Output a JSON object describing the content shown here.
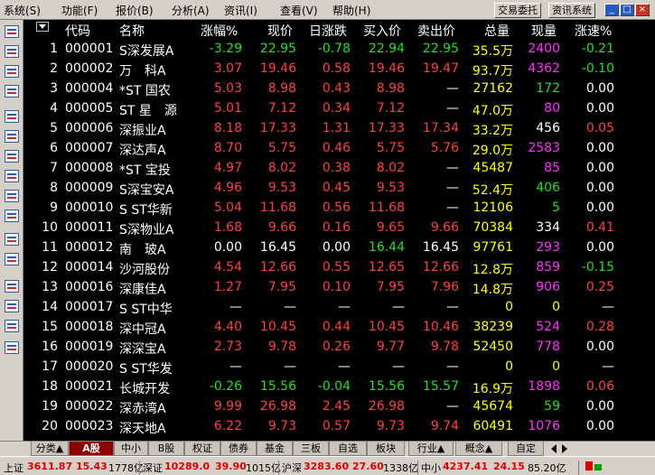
{
  "menu": [
    {
      "label": "系统(S)"
    },
    {
      "label": "功能(F)"
    },
    {
      "label": "报价(B)"
    },
    {
      "label": "分析(A)"
    },
    {
      "label": "资讯(I)"
    },
    {
      "label": "查看(V)"
    },
    {
      "label": "帮助(H)"
    }
  ],
  "toolbar": {
    "trade_label": "交易委托",
    "news_label": "资讯系统"
  },
  "columns": [
    "代码",
    "名称",
    "涨幅%",
    "现价",
    "日涨跌",
    "买入价",
    "卖出价",
    "总量",
    "现量",
    "涨速%"
  ],
  "rows": [
    {
      "n": "1",
      "code": "000001",
      "name": "S深发展A",
      "pct": "-3.29",
      "price": "22.95",
      "chg": "-0.78",
      "bid": "22.94",
      "ask": "22.95",
      "vol": "35.5万",
      "cur": "2400",
      "spd": "-0.21",
      "c": [
        "g",
        "g",
        "g",
        "g",
        "g",
        "m",
        "g"
      ]
    },
    {
      "n": "2",
      "code": "000002",
      "name": "万　科A",
      "pct": "3.07",
      "price": "19.46",
      "chg": "0.58",
      "bid": "19.46",
      "ask": "19.47",
      "vol": "93.7万",
      "cur": "4362",
      "spd": "-0.10",
      "c": [
        "r",
        "r",
        "r",
        "r",
        "r",
        "m",
        "g"
      ]
    },
    {
      "n": "3",
      "code": "000004",
      "name": "*ST 国农",
      "pct": "5.03",
      "price": "8.98",
      "chg": "0.43",
      "bid": "8.98",
      "ask": "—",
      "vol": "27162",
      "cur": "172",
      "spd": "0.00",
      "c": [
        "r",
        "r",
        "r",
        "r",
        "w",
        "g",
        "w"
      ]
    },
    {
      "n": "4",
      "code": "000005",
      "name": "ST 星　源",
      "pct": "5.01",
      "price": "7.12",
      "chg": "0.34",
      "bid": "7.12",
      "ask": "—",
      "vol": "47.0万",
      "cur": "80",
      "spd": "0.00",
      "c": [
        "r",
        "r",
        "r",
        "r",
        "w",
        "m",
        "w"
      ]
    },
    {
      "n": "5",
      "code": "000006",
      "name": "深振业A",
      "pct": "8.18",
      "price": "17.33",
      "chg": "1.31",
      "bid": "17.33",
      "ask": "17.34",
      "vol": "33.2万",
      "cur": "456",
      "spd": "0.05",
      "c": [
        "r",
        "r",
        "r",
        "r",
        "r",
        "w",
        "r"
      ]
    },
    {
      "n": "6",
      "code": "000007",
      "name": "深达声A",
      "pct": "8.70",
      "price": "5.75",
      "chg": "0.46",
      "bid": "5.75",
      "ask": "5.76",
      "vol": "29.0万",
      "cur": "2583",
      "spd": "0.00",
      "c": [
        "r",
        "r",
        "r",
        "r",
        "r",
        "m",
        "w"
      ]
    },
    {
      "n": "7",
      "code": "000008",
      "name": "*ST 宝投",
      "pct": "4.97",
      "price": "8.02",
      "chg": "0.38",
      "bid": "8.02",
      "ask": "—",
      "vol": "45487",
      "cur": "85",
      "spd": "0.00",
      "c": [
        "r",
        "r",
        "r",
        "r",
        "w",
        "m",
        "w"
      ]
    },
    {
      "n": "8",
      "code": "000009",
      "name": "S深宝安A",
      "pct": "4.96",
      "price": "9.53",
      "chg": "0.45",
      "bid": "9.53",
      "ask": "—",
      "vol": "52.4万",
      "cur": "406",
      "spd": "0.00",
      "c": [
        "r",
        "r",
        "r",
        "r",
        "w",
        "g",
        "w"
      ]
    },
    {
      "n": "9",
      "code": "000010",
      "name": "S ST华新",
      "pct": "5.04",
      "price": "11.68",
      "chg": "0.56",
      "bid": "11.68",
      "ask": "—",
      "vol": "12106",
      "cur": "5",
      "spd": "0.00",
      "c": [
        "r",
        "r",
        "r",
        "r",
        "w",
        "g",
        "w"
      ]
    },
    {
      "n": "10",
      "code": "000011",
      "name": "S深物业A",
      "pct": "1.68",
      "price": "9.66",
      "chg": "0.16",
      "bid": "9.65",
      "ask": "9.66",
      "vol": "70384",
      "cur": "334",
      "spd": "0.41",
      "c": [
        "r",
        "r",
        "r",
        "r",
        "r",
        "w",
        "r"
      ]
    },
    {
      "n": "11",
      "code": "000012",
      "name": "南　玻A",
      "pct": "0.00",
      "price": "16.45",
      "chg": "0.00",
      "bid": "16.44",
      "ask": "16.45",
      "vol": "97761",
      "cur": "293",
      "spd": "0.00",
      "c": [
        "w",
        "w",
        "w",
        "g",
        "w",
        "m",
        "w"
      ]
    },
    {
      "n": "12",
      "code": "000014",
      "name": "沙河股份",
      "pct": "4.54",
      "price": "12.66",
      "chg": "0.55",
      "bid": "12.65",
      "ask": "12.66",
      "vol": "12.8万",
      "cur": "859",
      "spd": "-0.15",
      "c": [
        "r",
        "r",
        "r",
        "r",
        "r",
        "m",
        "g"
      ]
    },
    {
      "n": "13",
      "code": "000016",
      "name": "深康佳A",
      "pct": "1.27",
      "price": "7.95",
      "chg": "0.10",
      "bid": "7.95",
      "ask": "7.96",
      "vol": "14.8万",
      "cur": "906",
      "spd": "0.25",
      "c": [
        "r",
        "r",
        "r",
        "r",
        "r",
        "m",
        "r"
      ]
    },
    {
      "n": "14",
      "code": "000017",
      "name": "S ST中华",
      "pct": "—",
      "price": "—",
      "chg": "—",
      "bid": "—",
      "ask": "—",
      "vol": "0",
      "cur": "0",
      "spd": "—",
      "c": [
        "w",
        "w",
        "w",
        "w",
        "w",
        "y",
        "w"
      ]
    },
    {
      "n": "15",
      "code": "000018",
      "name": "深中冠A",
      "pct": "4.40",
      "price": "10.45",
      "chg": "0.44",
      "bid": "10.45",
      "ask": "10.46",
      "vol": "38239",
      "cur": "524",
      "spd": "0.28",
      "c": [
        "r",
        "r",
        "r",
        "r",
        "r",
        "m",
        "r"
      ]
    },
    {
      "n": "16",
      "code": "000019",
      "name": "深深宝A",
      "pct": "2.73",
      "price": "9.78",
      "chg": "0.26",
      "bid": "9.77",
      "ask": "9.78",
      "vol": "52450",
      "cur": "778",
      "spd": "0.00",
      "c": [
        "r",
        "r",
        "r",
        "r",
        "r",
        "m",
        "w"
      ]
    },
    {
      "n": "17",
      "code": "000020",
      "name": "S ST华发",
      "pct": "—",
      "price": "—",
      "chg": "—",
      "bid": "—",
      "ask": "—",
      "vol": "0",
      "cur": "0",
      "spd": "—",
      "c": [
        "w",
        "w",
        "w",
        "w",
        "w",
        "y",
        "w"
      ]
    },
    {
      "n": "18",
      "code": "000021",
      "name": "长城开发",
      "pct": "-0.26",
      "price": "15.56",
      "chg": "-0.04",
      "bid": "15.56",
      "ask": "15.57",
      "vol": "16.9万",
      "cur": "1898",
      "spd": "0.06",
      "c": [
        "g",
        "g",
        "g",
        "g",
        "g",
        "m",
        "r"
      ]
    },
    {
      "n": "19",
      "code": "000022",
      "name": "深赤湾A",
      "pct": "9.99",
      "price": "26.98",
      "chg": "2.45",
      "bid": "26.98",
      "ask": "—",
      "vol": "45674",
      "cur": "59",
      "spd": "0.00",
      "c": [
        "r",
        "r",
        "r",
        "r",
        "w",
        "g",
        "w"
      ]
    },
    {
      "n": "20",
      "code": "000023",
      "name": "深天地A",
      "pct": "6.22",
      "price": "9.73",
      "chg": "0.57",
      "bid": "9.73",
      "ask": "9.74",
      "vol": "60491",
      "cur": "1076",
      "spd": "0.00",
      "c": [
        "r",
        "r",
        "r",
        "r",
        "r",
        "m",
        "w"
      ]
    }
  ],
  "tabs": [
    "分类▲",
    "A股",
    "中小",
    "B股",
    "权证",
    "债券",
    "基金",
    "三板",
    "自选",
    "板块",
    "行业▲",
    "概念▲",
    "自定"
  ],
  "status": {
    "sh_label": "上证",
    "sh_value": "3611.87",
    "sh_chg": "15.43",
    "sh_amt": "1778亿",
    "sz_label": "深证",
    "sz_value": "10289.0",
    "sz_chg": "39.90",
    "sz_amt": "1015亿",
    "hs_label": "沪深",
    "hs_value": "3283.60",
    "hs_chg": "27.60",
    "hs_amt": "1338亿",
    "zx_label": "中小",
    "zx_value": "4237.41",
    "zx_chg": "24.15",
    "zx_amt": "85.20亿"
  },
  "colors": {
    "up": "#ff4040",
    "down": "#20e020",
    "volume": "#ffff00",
    "current_vol": "#ff30ff",
    "active_tab": "#8c0000"
  }
}
